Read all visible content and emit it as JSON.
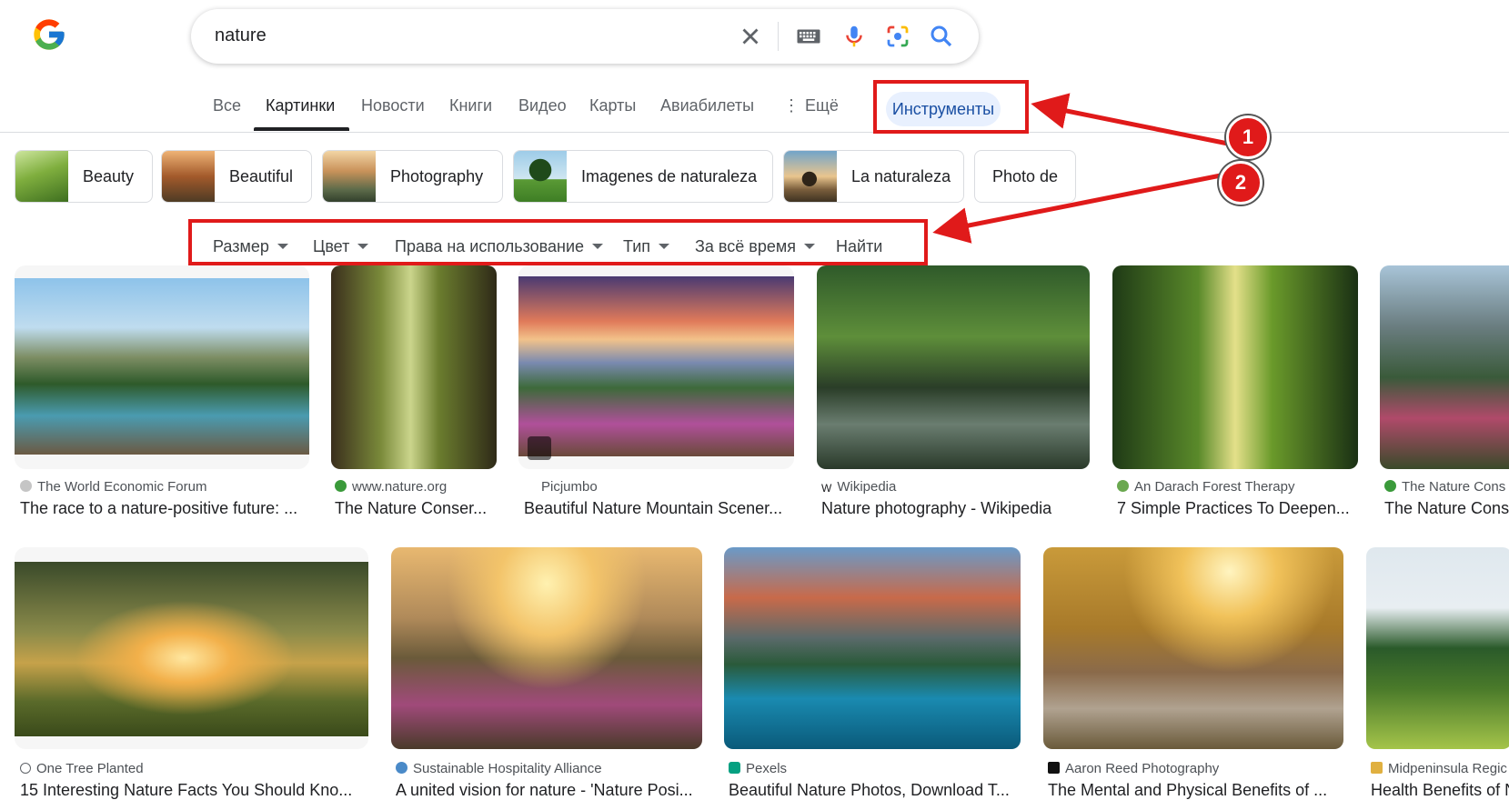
{
  "search": {
    "query": "nature"
  },
  "tabs": [
    {
      "label": "Все"
    },
    {
      "label": "Картинки"
    },
    {
      "label": "Новости"
    },
    {
      "label": "Книги"
    },
    {
      "label": "Видео"
    },
    {
      "label": "Карты"
    },
    {
      "label": "Авиабилеты"
    },
    {
      "label": "Ещё"
    }
  ],
  "tools_label": "Инструменты",
  "chips": [
    {
      "label": "Beauty"
    },
    {
      "label": "Beautiful"
    },
    {
      "label": "Photography"
    },
    {
      "label": "Imagenes de naturaleza"
    },
    {
      "label": "La naturaleza"
    },
    {
      "label": "Photo de"
    }
  ],
  "filters": [
    {
      "label": "Размер"
    },
    {
      "label": "Цвет"
    },
    {
      "label": "Права на использование"
    },
    {
      "label": "Тип"
    },
    {
      "label": "За всё время"
    },
    {
      "label": "Найти"
    }
  ],
  "results": [
    {
      "source": "The World Economic Forum",
      "title": "The race to a nature-positive future: ..."
    },
    {
      "source": "www.nature.org",
      "title": "The Nature Conser..."
    },
    {
      "source": "Picjumbo",
      "title": "Beautiful Nature Mountain Scener..."
    },
    {
      "source": "Wikipedia",
      "title": "Nature photography - Wikipedia"
    },
    {
      "source": "An Darach Forest Therapy",
      "title": "7 Simple Practices To Deepen..."
    },
    {
      "source": "The Nature Cons",
      "title": "The Nature Cons"
    },
    {
      "source": "One Tree Planted",
      "title": "15 Interesting Nature Facts You Should Kno..."
    },
    {
      "source": "Sustainable Hospitality Alliance",
      "title": "A united vision for nature - 'Nature Posi..."
    },
    {
      "source": "Pexels",
      "title": "Beautiful Nature Photos, Download T..."
    },
    {
      "source": "Aaron Reed Photography",
      "title": "The Mental and Physical Benefits of ..."
    },
    {
      "source": "Midpeninsula Regic",
      "title": "Health Benefits of N"
    }
  ],
  "callouts": [
    "1",
    "2"
  ],
  "colors": {
    "annotation_red": "#e01a1a",
    "tools_bg": "#e8f0fe",
    "tools_text": "#1a4fa3"
  }
}
